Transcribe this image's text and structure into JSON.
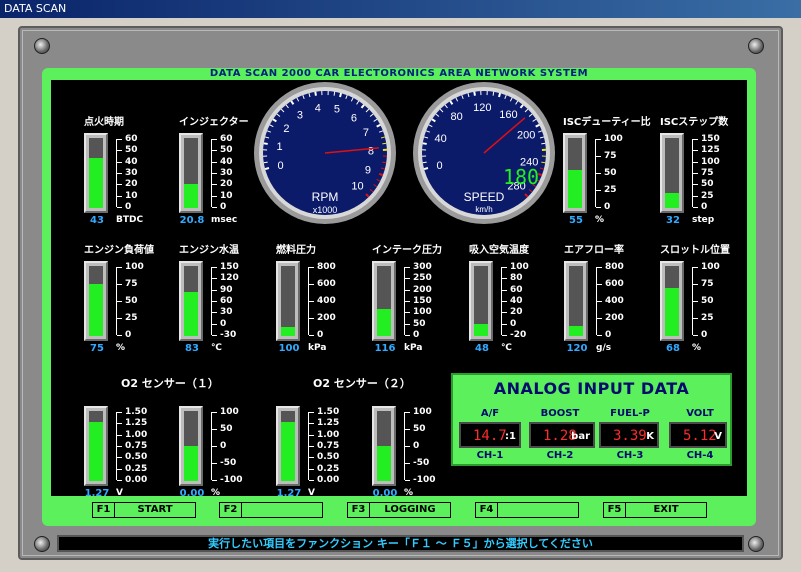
{
  "window": {
    "title": "DATA SCAN"
  },
  "header": {
    "title": "DATA SCAN 2000   CAR ELECTORONICS  AREA  NETWORK  SYSTEM"
  },
  "rpm": {
    "label": "RPM",
    "sublabel": "x1000",
    "ticks": [
      "0",
      "1",
      "2",
      "3",
      "4",
      "5",
      "6",
      "7",
      "8",
      "9",
      "10"
    ],
    "value": 7.9
  },
  "speed": {
    "label": "SPEED",
    "sublabel": "km/h",
    "ticks": [
      "0",
      "40",
      "80",
      "120",
      "160",
      "200",
      "240",
      "280"
    ],
    "value": 180,
    "digital": "180"
  },
  "meters": [
    {
      "id": "ignition",
      "label": "点火時期",
      "value": "43",
      "unit": "BTDC",
      "ticks": [
        "60",
        "50",
        "40",
        "30",
        "20",
        "10",
        "0"
      ],
      "fill": 0.71
    },
    {
      "id": "injector",
      "label": "インジェクター",
      "value": "20.8",
      "unit": "msec",
      "ticks": [
        "60",
        "50",
        "40",
        "30",
        "20",
        "10",
        "0"
      ],
      "fill": 0.35
    },
    {
      "id": "isc-duty",
      "label": "ISCデューティー比",
      "value": "55",
      "unit": "%",
      "ticks": [
        "100",
        "75",
        "50",
        "25",
        "0"
      ],
      "fill": 0.55
    },
    {
      "id": "isc-step",
      "label": "ISCステップ数",
      "value": "32",
      "unit": "step",
      "ticks": [
        "150",
        "125",
        "100",
        "75",
        "50",
        "25",
        "0"
      ],
      "fill": 0.22
    },
    {
      "id": "engine-load",
      "label": "エンジン負荷値",
      "value": "75",
      "unit": "%",
      "ticks": [
        "100",
        "75",
        "50",
        "25",
        "0"
      ],
      "fill": 0.75
    },
    {
      "id": "coolant",
      "label": "エンジン水温",
      "value": "83",
      "unit": "℃",
      "ticks": [
        "150",
        "120",
        "90",
        "60",
        "30",
        "0",
        "-30"
      ],
      "fill": 0.63
    },
    {
      "id": "fuel-pressure",
      "label": "燃料圧力",
      "value": "100",
      "unit": "kPa",
      "ticks": [
        "800",
        "600",
        "400",
        "200",
        "0"
      ],
      "fill": 0.13
    },
    {
      "id": "intake-pressure",
      "label": "インテーク圧力",
      "value": "116",
      "unit": "kPa",
      "ticks": [
        "300",
        "250",
        "200",
        "150",
        "100",
        "50",
        "0"
      ],
      "fill": 0.38
    },
    {
      "id": "intake-temp",
      "label": "吸入空気温度",
      "value": "48",
      "unit": "℃",
      "ticks": [
        "100",
        "80",
        "60",
        "40",
        "20",
        "0",
        "-20"
      ],
      "fill": 0.17
    },
    {
      "id": "airflow",
      "label": "エアフロー率",
      "value": "120",
      "unit": "g/s",
      "ticks": [
        "800",
        "600",
        "400",
        "200",
        "0"
      ],
      "fill": 0.15
    },
    {
      "id": "throttle",
      "label": "スロットル位置",
      "value": "68",
      "unit": "%",
      "ticks": [
        "100",
        "75",
        "50",
        "25",
        "0"
      ],
      "fill": 0.68
    },
    {
      "id": "o2-1-v",
      "label": "",
      "value": "1.27",
      "unit": "V",
      "ticks": [
        "1.50",
        "1.25",
        "1.00",
        "0.75",
        "0.50",
        "0.25",
        "0.00"
      ],
      "fill": 0.85
    },
    {
      "id": "o2-1-pct",
      "label": "",
      "value": "0.00",
      "unit": "%",
      "ticks": [
        "100",
        "50",
        "0",
        "-50",
        "-100"
      ],
      "fill": 0.5
    },
    {
      "id": "o2-2-v",
      "label": "",
      "value": "1.27",
      "unit": "V",
      "ticks": [
        "1.50",
        "1.25",
        "1.00",
        "0.75",
        "0.50",
        "0.25",
        "0.00"
      ],
      "fill": 0.85
    },
    {
      "id": "o2-2-pct",
      "label": "",
      "value": "0.00",
      "unit": "%",
      "ticks": [
        "100",
        "50",
        "0",
        "-50",
        "-100"
      ],
      "fill": 0.5
    }
  ],
  "o2_labels": [
    "O2 センサー（１）",
    "O2 センサー（２）"
  ],
  "analog": {
    "title": "ANALOG  INPUT  DATA",
    "channels": [
      {
        "label": "A/F",
        "value": "14.7",
        "unit": ":1",
        "channel": "CH-1"
      },
      {
        "label": "BOOST",
        "value": "1.28",
        "unit": "bar",
        "channel": "CH-2"
      },
      {
        "label": "FUEL-P",
        "value": "3.39",
        "unit": "K",
        "channel": "CH-3"
      },
      {
        "label": "VOLT",
        "value": "5.12",
        "unit": "V",
        "channel": "CH-4"
      }
    ]
  },
  "fkeys": [
    {
      "key": "F1",
      "label": "START"
    },
    {
      "key": "F2",
      "label": ""
    },
    {
      "key": "F3",
      "label": "LOGGING"
    },
    {
      "key": "F4",
      "label": ""
    },
    {
      "key": "F5",
      "label": "EXIT"
    }
  ],
  "status": "実行したい項目をファンクション キー「Ｆ１ ～ Ｆ５」から選択してください",
  "colors": {
    "panel": "#5cf05c",
    "bar_fill": "#22ee22",
    "value_text": "#33aaff",
    "analog_value": "#ff2a2a",
    "gauge_face": "#0c1a6a"
  }
}
